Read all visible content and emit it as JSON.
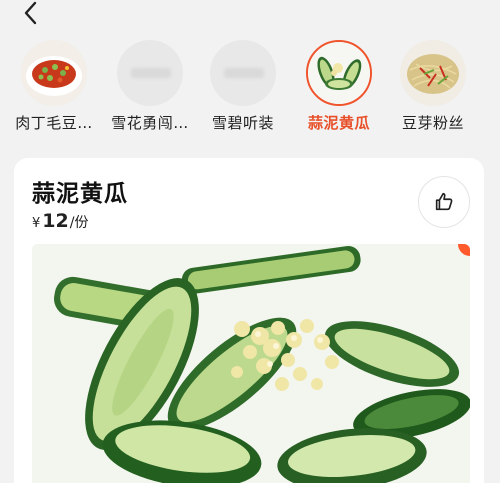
{
  "nav": {
    "back_icon": "chevron-left-icon"
  },
  "dishes": [
    {
      "label": "肉丁毛豆…",
      "selected": false
    },
    {
      "label": "雪花勇闯…",
      "selected": false
    },
    {
      "label": "雪碧听装",
      "selected": false
    },
    {
      "label": "蒜泥黄瓜",
      "selected": true
    },
    {
      "label": "豆芽粉丝",
      "selected": false
    }
  ],
  "detail": {
    "title": "蒜泥黄瓜",
    "currency": "¥",
    "price": "12",
    "unit": "/份",
    "like_icon": "thumbs-up-icon"
  },
  "colors": {
    "accent": "#e8502a",
    "background": "#f2f2f2",
    "card": "#ffffff"
  }
}
